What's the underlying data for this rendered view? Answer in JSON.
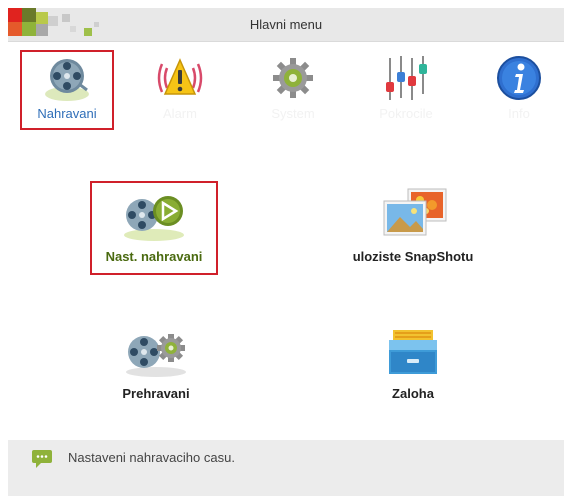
{
  "window": {
    "title": "Hlavni menu"
  },
  "top_menu": [
    {
      "label": "Nahravani",
      "icon": "film-reel-icon",
      "active": true
    },
    {
      "label": "Alarm",
      "icon": "alarm-warning-icon",
      "active": false
    },
    {
      "label": "System",
      "icon": "gear-icon",
      "active": false
    },
    {
      "label": "Pokrocile",
      "icon": "sliders-icon",
      "active": false
    },
    {
      "label": "Info",
      "icon": "info-icon",
      "active": false
    }
  ],
  "sub_menu": [
    {
      "label": "Nast. nahravani",
      "icon": "record-settings-icon",
      "active": true
    },
    {
      "label": "uloziste SnapShotu",
      "icon": "snapshot-images-icon",
      "active": false
    },
    {
      "label": "Prehravani",
      "icon": "playback-reel-icon",
      "active": false
    },
    {
      "label": "Zaloha",
      "icon": "backup-cabinet-icon",
      "active": false
    }
  ],
  "status": {
    "text": "Nastaveni nahravaciho casu.",
    "icon": "message-icon"
  },
  "colors": {
    "accent": "#d0202a",
    "active_top_label": "#2f6eb8",
    "active_sub_label": "#4a6a10"
  }
}
